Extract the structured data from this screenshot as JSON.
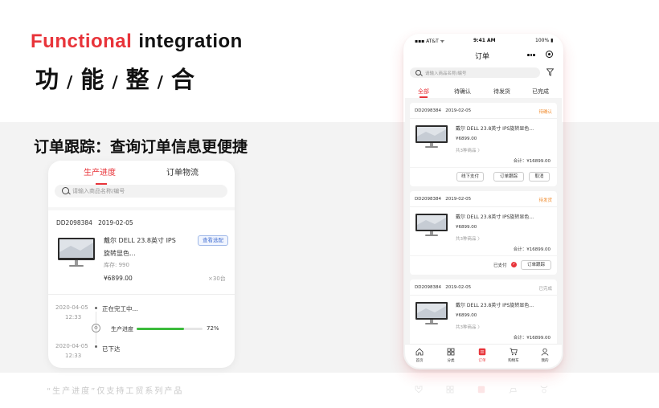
{
  "hero": {
    "en_red": "Functional",
    "en_black": "integration",
    "cn_chars": [
      "功",
      "能",
      "整",
      "合"
    ],
    "separator": "/"
  },
  "feature_title": "订单跟踪：查询订单信息更便捷",
  "footnote": "“生产进度”仅支持工贸系列产品",
  "tracking_card": {
    "tabs": [
      "生产进度",
      "订单物流"
    ],
    "search_placeholder": "请输入商品名称/编号",
    "order_id": "DD2098384",
    "order_date": "2019-02-05",
    "product_line1": "戴尔 DELL 23.8英寸 IPS",
    "product_line2": "旋转显色...",
    "stock": "库存: 990",
    "price": "¥6899.00",
    "qty": "×30台",
    "chip_label": "查看选配",
    "timeline": [
      {
        "date": "2020-04-05",
        "time": "12:33",
        "text": "正在完工中..."
      },
      {
        "date": "2020-04-05",
        "time": "12:33",
        "text": "已下达"
      }
    ],
    "progress_label": "生产进度",
    "progress_value": 0.72,
    "progress_text": "72%"
  },
  "phone": {
    "status": {
      "carrier": "AT&T",
      "time": "9:41 AM",
      "battery": "100%"
    },
    "title": "订单",
    "search_placeholder": "请输入商品名称/编号",
    "tabs": [
      "全部",
      "待确认",
      "待发货",
      "已完成"
    ],
    "orders": [
      {
        "id": "DD2098384",
        "date": "2019-02-05",
        "status": "待确认",
        "status_color": "#f08a2c",
        "name": "戴尔 DELL 23.8英寸 IPS旋转显色...",
        "price": "¥6899.00",
        "count": "共3种商品 〉",
        "total": "合计：¥16899.00",
        "buttons": [
          "线下支付",
          "订单跟踪",
          "取消"
        ],
        "paid_label": ""
      },
      {
        "id": "DD2098384",
        "date": "2019-02-05",
        "status": "待发货",
        "status_color": "#f08a2c",
        "name": "戴尔 DELL 23.8英寸 IPS旋转显色...",
        "price": "¥6899.00",
        "count": "共3种商品 〉",
        "total": "合计：¥16899.00",
        "buttons": [
          "订单跟踪"
        ],
        "paid_label": "已支付"
      },
      {
        "id": "DD2098384",
        "date": "2019-02-05",
        "status": "已完成",
        "status_color": "#999999",
        "name": "戴尔 DELL 23.8英寸 IPS旋转显色...",
        "price": "¥6899.00",
        "count": "共3种商品 〉",
        "total": "合计：¥16899.00",
        "buttons": [],
        "paid_label": ""
      }
    ],
    "tabbar": [
      {
        "label": "首页",
        "icon": "home-icon"
      },
      {
        "label": "分类",
        "icon": "grid-icon"
      },
      {
        "label": "订单",
        "icon": "order-icon"
      },
      {
        "label": "购物车",
        "icon": "cart-icon"
      },
      {
        "label": "我的",
        "icon": "user-icon"
      }
    ],
    "accent": "#e8343a"
  }
}
